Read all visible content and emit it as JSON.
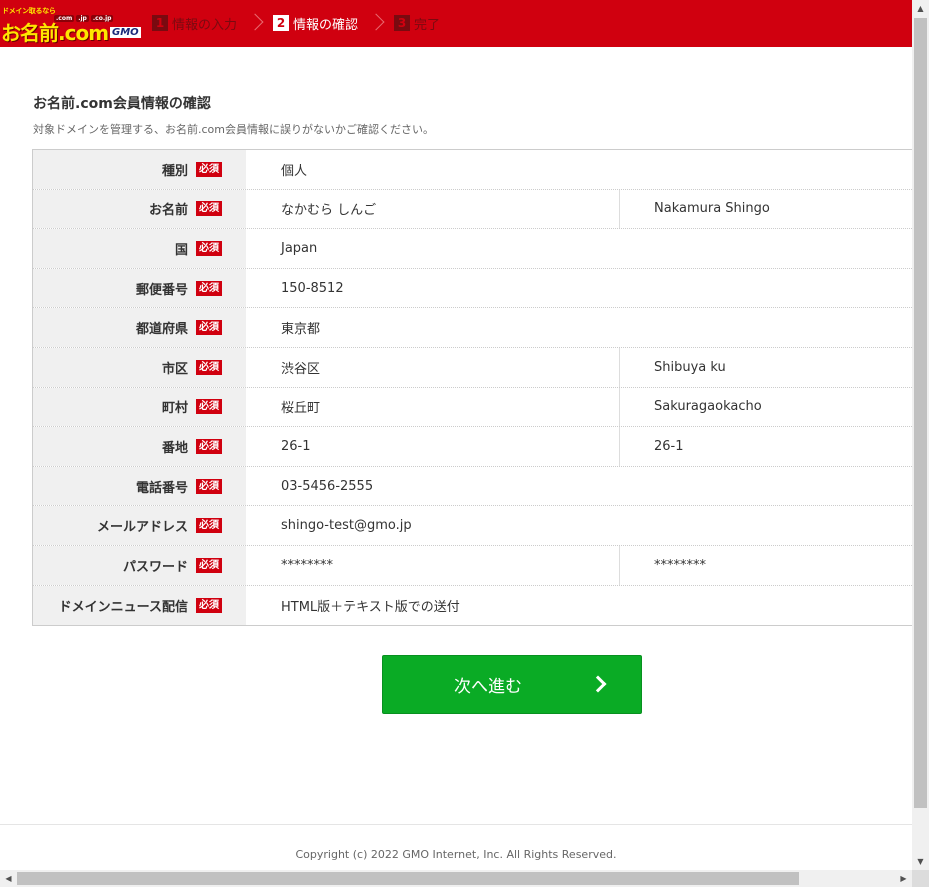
{
  "header": {
    "logo_tagline": "ドメイン取るなら",
    "logo_tlds": [
      ".com",
      ".jp",
      ".co.jp"
    ],
    "logo_text": "お名前.com",
    "logo_gmo": "GMO",
    "steps": [
      {
        "num": "1",
        "label": "情報の入力",
        "state": "inactive"
      },
      {
        "num": "2",
        "label": "情報の確認",
        "state": "active"
      },
      {
        "num": "3",
        "label": "完了",
        "state": "inactive"
      }
    ]
  },
  "main": {
    "title": "お名前.com会員情報の確認",
    "subtitle": "対象ドメインを管理する、お名前.com会員情報に誤りがないかご確認ください。",
    "required_badge": "必須",
    "rows": [
      {
        "label": "種別",
        "value": "個人",
        "value2": null
      },
      {
        "label": "お名前",
        "value": "なかむら しんご",
        "value2": "Nakamura Shingo"
      },
      {
        "label": "国",
        "value": "Japan",
        "value2": null
      },
      {
        "label": "郵便番号",
        "value": "150-8512",
        "value2": null
      },
      {
        "label": "都道府県",
        "value": "東京都",
        "value2": null
      },
      {
        "label": "市区",
        "value": "渋谷区",
        "value2": "Shibuya ku"
      },
      {
        "label": "町村",
        "value": "桜丘町",
        "value2": "Sakuragaokacho"
      },
      {
        "label": "番地",
        "value": "26-1",
        "value2": "26-1"
      },
      {
        "label": "電話番号",
        "value": "03-5456-2555",
        "value2": null
      },
      {
        "label": "メールアドレス",
        "value": "shingo-test@gmo.jp",
        "value2": null
      },
      {
        "label": "パスワード",
        "value": "********",
        "value2": "********"
      },
      {
        "label": "ドメインニュース配信",
        "value": "HTML版＋テキスト版での送付",
        "value2": null
      }
    ],
    "next_button": "次へ進む"
  },
  "footer": {
    "copyright": "Copyright (c) 2022 GMO Internet, Inc. All Rights Reserved."
  },
  "colors": {
    "brand_red": "#d0000f",
    "button_green": "#0aab25"
  }
}
